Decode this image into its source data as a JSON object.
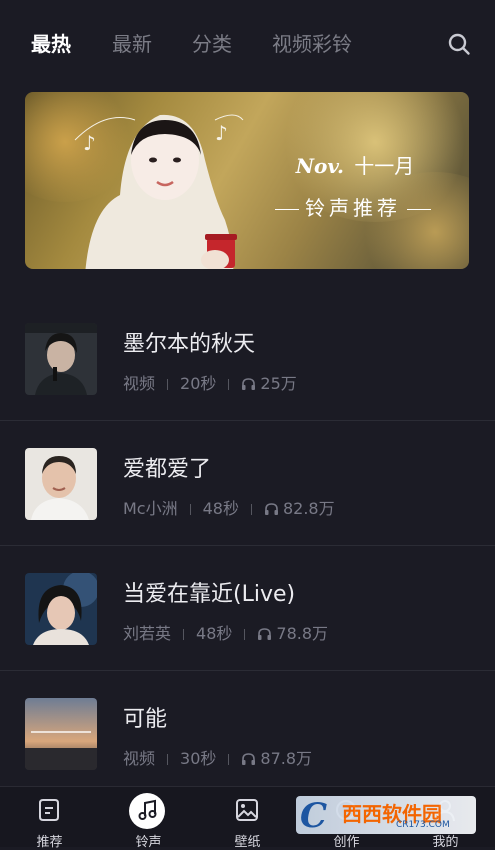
{
  "top_tabs": [
    {
      "label": "最热",
      "active": true
    },
    {
      "label": "最新",
      "active": false
    },
    {
      "label": "分类",
      "active": false
    },
    {
      "label": "视频彩铃",
      "active": false
    }
  ],
  "banner": {
    "month_latin": "Nov.",
    "month_cn": "十一月",
    "subtitle": "铃声推荐"
  },
  "ringtones": [
    {
      "title": "墨尔本的秋天",
      "source": "视频",
      "duration": "20秒",
      "plays": "25万"
    },
    {
      "title": "爱都爱了",
      "source": "Mc小洲",
      "duration": "48秒",
      "plays": "82.8万"
    },
    {
      "title": "当爱在靠近(Live)",
      "source": "刘若英",
      "duration": "48秒",
      "plays": "78.8万"
    },
    {
      "title": "可能",
      "source": "视频",
      "duration": "30秒",
      "plays": "87.8万"
    }
  ],
  "bottom_nav": [
    {
      "label": "推荐",
      "icon": "recommend-icon",
      "active": false
    },
    {
      "label": "铃声",
      "icon": "music-note-icon",
      "active": true
    },
    {
      "label": "壁纸",
      "icon": "wallpaper-icon",
      "active": false
    },
    {
      "label": "创作",
      "icon": "create-icon",
      "active": false
    },
    {
      "label": "我的",
      "icon": "profile-icon",
      "active": false
    }
  ],
  "watermark": {
    "text": "西西软件园",
    "url": "CR173.COM"
  },
  "colors": {
    "background": "#1b1b24",
    "active_tab": "#ffffff",
    "inactive_tab": "#7b7c86",
    "meta": "#787986"
  }
}
